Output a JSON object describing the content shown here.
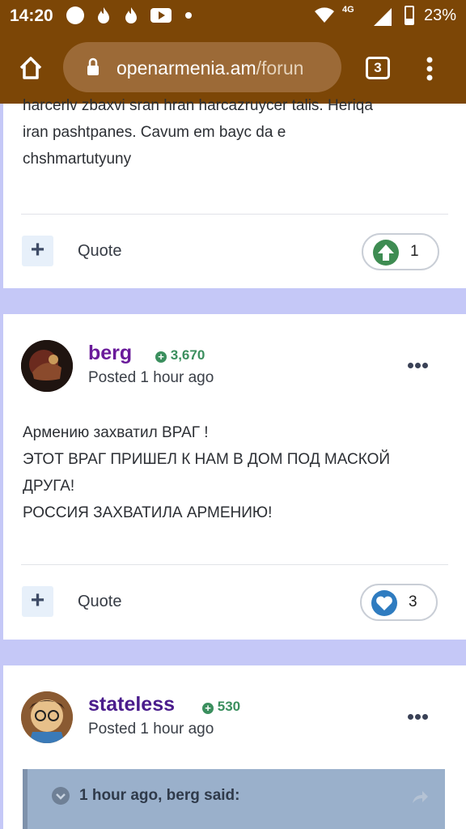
{
  "status_bar": {
    "time": "14:20",
    "network": "4G",
    "battery": "23%"
  },
  "browser": {
    "url_host": "openarmenia.am",
    "url_path": "/forun",
    "tab_count": "3"
  },
  "posts": [
    {
      "body_lines": [
        "harcerlv zbaxvi sran hran harcazruycer talis. Heriqa",
        "iran pashtpanes. Cavum em bayc da e",
        "chshmartutyuny"
      ],
      "quote_label": "Quote",
      "reaction_count": "1",
      "reaction_icon": "upvote-icon"
    },
    {
      "author": "berg",
      "reputation": "3,670",
      "posted": "Posted 1 hour ago",
      "body_lines": [
        "Армению захватил ВРАГ !",
        "ЭТОТ ВРАГ ПРИШЕЛ К НАМ В ДОМ ПОД МАСКОЙ",
        "ДРУГА!",
        "РОССИЯ ЗАХВАТИЛА АРМЕНИЮ!"
      ],
      "quote_label": "Quote",
      "reaction_count": "3",
      "reaction_icon": "heart-icon"
    },
    {
      "author": "stateless",
      "reputation": "530",
      "posted": "Posted 1 hour ago",
      "quoted_header": "1 hour ago, berg said:"
    }
  ],
  "colors": {
    "chrome": "#7c4606",
    "page_bg": "#c5c8f7",
    "username": "#6a1b9a",
    "reputation": "#3b8f5e",
    "upvote": "#3e8c52",
    "heart": "#2f7cc0"
  }
}
